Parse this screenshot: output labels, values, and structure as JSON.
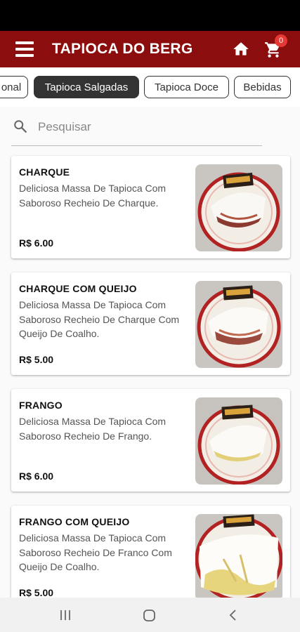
{
  "app": {
    "title": "TAPIOCA DO BERG",
    "cart_count": "0",
    "colors": {
      "brand": "#8b0d0d",
      "badge": "#e53935"
    }
  },
  "tabs": [
    {
      "label": "onal",
      "active": false
    },
    {
      "label": "Tapioca Salgadas",
      "active": true
    },
    {
      "label": "Tapioca Doce",
      "active": false
    },
    {
      "label": "Bebidas",
      "active": false
    }
  ],
  "search": {
    "placeholder": "Pesquisar",
    "value": ""
  },
  "products": [
    {
      "name": "CHARQUE",
      "description": "Deliciosa Massa De Tapioca Com Saboroso Recheio De Charque.",
      "price": "R$ 6.00"
    },
    {
      "name": "CHARQUE COM QUEIJO",
      "description": "Deliciosa Massa De Tapioca Com Saboroso Recheio De Charque Com Queijo De Coalho.",
      "price": "R$ 5.00"
    },
    {
      "name": "FRANGO",
      "description": "Deliciosa Massa De Tapioca Com Saboroso Recheio De Frango.",
      "price": "R$ 6.00"
    },
    {
      "name": "FRANGO COM QUEIJO",
      "description": "Deliciosa Massa De Tapioca Com Saboroso Recheio De Franco Com Queijo De Coalho.",
      "price": "R$ 5.00"
    }
  ],
  "icons": {
    "menu": "menu-icon",
    "home": "home-icon",
    "cart": "cart-icon",
    "search": "search-icon",
    "recents": "recents-icon",
    "home_nav": "home-nav-icon",
    "back": "back-icon"
  }
}
